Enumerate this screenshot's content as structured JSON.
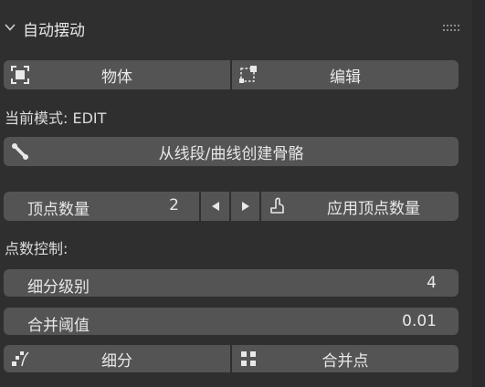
{
  "panel": {
    "title": "自动摆动",
    "mode_buttons": {
      "object": "物体",
      "edit": "编辑"
    },
    "mode_label": "当前模式: EDIT",
    "create_bones_button": "从线段/曲线创建骨骼",
    "vertex_count": {
      "label": "顶点数量",
      "value": "2",
      "apply_label": "应用顶点数量"
    },
    "point_control_label": "点数控制:",
    "subdivision_level": {
      "label": "细分级别",
      "value": "4"
    },
    "merge_threshold": {
      "label": "合并阈值",
      "value": "0.01"
    },
    "bottom_buttons": {
      "subdivide": "细分",
      "merge_points": "合并点"
    }
  },
  "colors": {
    "panel_bg": "#2f2f2f",
    "button_bg": "#545454",
    "text": "#e8e8e8"
  },
  "icons": [
    "chevron-down-icon",
    "drag-grip-icon",
    "object-mode-icon",
    "edit-mode-icon",
    "bone-icon",
    "triangle-left-icon",
    "triangle-right-icon",
    "curve-icon",
    "subdivide-icon",
    "merge-icon"
  ]
}
